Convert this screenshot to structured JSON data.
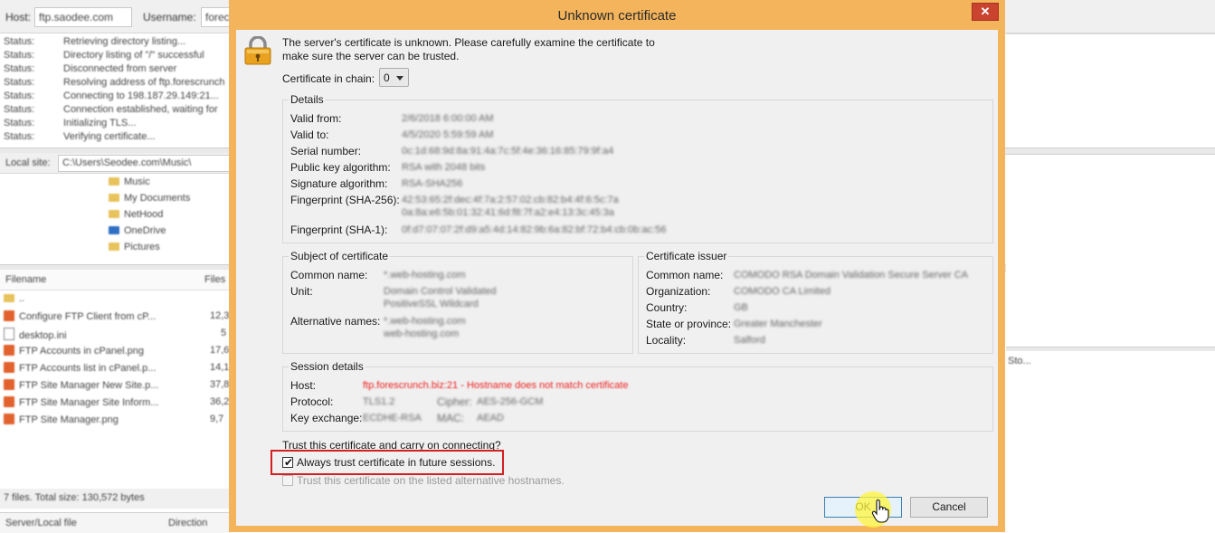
{
  "background": {
    "topbar": {
      "host_label": "Host:",
      "host_value": "ftp.saodee.com",
      "username_label": "Username:",
      "username_value": "forec"
    },
    "log": [
      {
        "label": "Status:",
        "text": "Retrieving directory listing..."
      },
      {
        "label": "Status:",
        "text": "Directory listing of \"/\" successful"
      },
      {
        "label": "Status:",
        "text": "Disconnected from server"
      },
      {
        "label": "Status:",
        "text": "Resolving address of ftp.forescrunch"
      },
      {
        "label": "Status:",
        "text": "Connecting to 198.187.29.149:21..."
      },
      {
        "label": "Status:",
        "text": "Connection established, waiting for"
      },
      {
        "label": "Status:",
        "text": "Initializing TLS..."
      },
      {
        "label": "Status:",
        "text": "Verifying certificate..."
      }
    ],
    "local_site_label": "Local site:",
    "local_site_path": "C:\\Users\\Seodee.com\\Music\\",
    "tree": [
      "Music",
      "My Documents",
      "NetHood",
      "OneDrive",
      "Pictures"
    ],
    "file_header": {
      "filename": "Filename",
      "filesize": "Files"
    },
    "files": [
      {
        "name": "..",
        "size": ""
      },
      {
        "name": "Configure FTP Client from cP...",
        "size": "12,3"
      },
      {
        "name": "desktop.ini",
        "size": "5"
      },
      {
        "name": "FTP Accounts in cPanel.png",
        "size": "17,6"
      },
      {
        "name": "FTP Accounts list in cPanel.p...",
        "size": "14,1"
      },
      {
        "name": "FTP Site Manager New Site.p...",
        "size": "37,8"
      },
      {
        "name": "FTP Site Manager Site Inform...",
        "size": "36,2"
      },
      {
        "name": "FTP Site Manager.png",
        "size": "9,7"
      }
    ],
    "status_text": "7 files. Total size: 130,572 bytes",
    "queue_header": {
      "server_local": "Server/Local file",
      "direction": "Direction"
    },
    "right_snippet": "Sto..."
  },
  "dialog": {
    "title": "Unknown certificate",
    "close_glyph": "✕",
    "message": "The server's certificate is unknown. Please carefully examine the certificate to make sure the server can be trusted.",
    "chain_label": "Certificate in chain:",
    "chain_value": "0",
    "details": {
      "title": "Details",
      "valid_from": {
        "label": "Valid from:",
        "value": "2/6/2018 6:00:00 AM"
      },
      "valid_to": {
        "label": "Valid to:",
        "value": "4/5/2020 5:59:59 AM"
      },
      "serial": {
        "label": "Serial number:",
        "value": "0c:1d:68:9d:8a:91:4a:7c:5f:4e:36:16:85:79:9f:a4"
      },
      "pubkey": {
        "label": "Public key algorithm:",
        "value": "RSA with 2048 bits"
      },
      "sigalg": {
        "label": "Signature algorithm:",
        "value": "RSA-SHA256"
      },
      "sha256": {
        "label": "Fingerprint (SHA-256):",
        "value_line1": "42:53:65:2f:dec:4f:7a:2:57:02:cb:82:b4:4f:6:5c:7a",
        "value_line2": "0a:8a:e6:5b:01:32:41:6d:f8:7f:a2:e4:13:3c:45:3a"
      },
      "sha1": {
        "label": "Fingerprint (SHA-1):",
        "value": "0f:d7:07:07:2f:d9:a5:4d:14:82:9b:6a:82:bf:72:b4:cb:0b:ac:56"
      }
    },
    "subject": {
      "title": "Subject of certificate",
      "common_name": {
        "label": "Common name:",
        "value": "*.web-hosting.com"
      },
      "unit": {
        "label": "Unit:",
        "value_line1": "Domain Control Validated",
        "value_line2": "PositiveSSL Wildcard"
      },
      "alt_names": {
        "label": "Alternative names:",
        "value_line1": "*.web-hosting.com",
        "value_line2": "web-hosting.com"
      }
    },
    "issuer": {
      "title": "Certificate issuer",
      "common_name": {
        "label": "Common name:",
        "value": "COMODO RSA Domain Validation Secure Server CA"
      },
      "organization": {
        "label": "Organization:",
        "value": "COMODO CA Limited"
      },
      "country": {
        "label": "Country:",
        "value": "GB"
      },
      "state": {
        "label": "State or province:",
        "value": "Greater Manchester"
      },
      "locality": {
        "label": "Locality:",
        "value": "Salford"
      }
    },
    "session": {
      "title": "Session details",
      "host": {
        "label": "Host:",
        "value": "ftp.forescrunch.biz:21 - Hostname does not match certificate"
      },
      "protocol": {
        "label": "Protocol:",
        "value": "TLS1.2"
      },
      "cipher": {
        "label": "Cipher:",
        "value": "AES-256-GCM"
      },
      "keyex": {
        "label": "Key exchange:",
        "value": "ECDHE-RSA"
      },
      "mac": {
        "label": "MAC:",
        "value": "AEAD"
      }
    },
    "trust_question": "Trust this certificate and carry on connecting?",
    "always_trust": {
      "label": "Always trust certificate in future sessions.",
      "checked": true
    },
    "trust_alt": {
      "label": "Trust this certificate on the listed alternative hostnames.",
      "checked": false
    },
    "ok_label": "OK",
    "cancel_label": "Cancel"
  },
  "colors": {
    "dialog_frame": "#f3b45c",
    "close_button": "#c9432f",
    "highlight": "#d42020",
    "warning_text": "#ee2222"
  }
}
